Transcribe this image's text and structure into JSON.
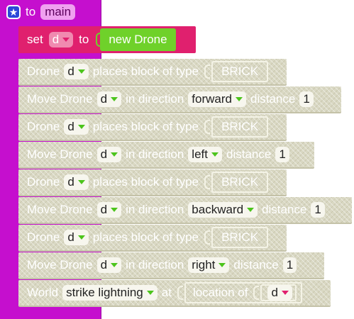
{
  "procedure": {
    "keyword": "to",
    "name": "main",
    "icon": "star-icon"
  },
  "set_block": {
    "set_label": "set",
    "variable": "d",
    "to_label": "to",
    "value": "new Drone"
  },
  "rows": [
    {
      "kind": "place",
      "prefix": "Drone",
      "var": "d",
      "text": "places block of type",
      "block": "BRICK"
    },
    {
      "kind": "move",
      "prefix": "Move Drone",
      "var": "d",
      "text": "in direction",
      "direction": "forward",
      "distance_label": "distance",
      "distance": "1"
    },
    {
      "kind": "place",
      "prefix": "Drone",
      "var": "d",
      "text": "places block of type",
      "block": "BRICK"
    },
    {
      "kind": "move",
      "prefix": "Move Drone",
      "var": "d",
      "text": "in direction",
      "direction": "left",
      "distance_label": "distance",
      "distance": "1"
    },
    {
      "kind": "place",
      "prefix": "Drone",
      "var": "d",
      "text": "places block of type",
      "block": "BRICK"
    },
    {
      "kind": "move",
      "prefix": "Move Drone",
      "var": "d",
      "text": "in direction",
      "direction": "backward",
      "distance_label": "distance",
      "distance": "1"
    },
    {
      "kind": "place",
      "prefix": "Drone",
      "var": "d",
      "text": "places block of type",
      "block": "BRICK"
    },
    {
      "kind": "move",
      "prefix": "Move Drone",
      "var": "d",
      "text": "in direction",
      "direction": "right",
      "distance_label": "distance",
      "distance": "1"
    }
  ],
  "world_block": {
    "prefix": "World",
    "action": "strike lightning",
    "at_label": "at",
    "location_label": "location of",
    "var": "d"
  },
  "colors": {
    "procedure": "#c50fce",
    "set": "#e0206e",
    "new_drone": "#6fd12a",
    "statement": "#d9d8c3"
  }
}
